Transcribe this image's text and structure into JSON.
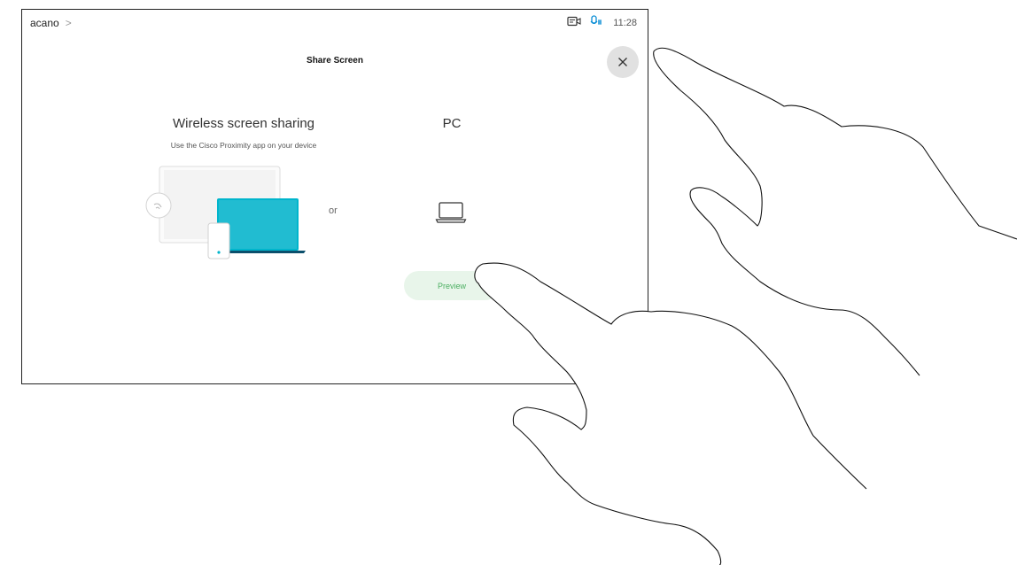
{
  "header": {
    "breadcrumb": "acano",
    "breadcrumb_chevron": ">",
    "time": "11:28",
    "icons": [
      "camera-icon",
      "microphone-status-icon"
    ]
  },
  "dialog": {
    "title": "Share Screen",
    "close_icon": "close-icon"
  },
  "wireless": {
    "title": "Wireless screen sharing",
    "subtitle": "Use the Cisco Proximity app on your device"
  },
  "separator": "or",
  "pc": {
    "title": "PC",
    "icon": "laptop-icon",
    "button_label": "Preview"
  },
  "colors": {
    "accent": "#00b5cc",
    "preview_bg": "#e8f5ea",
    "preview_text": "#4caf62",
    "close_bg": "#e1e1e1"
  }
}
